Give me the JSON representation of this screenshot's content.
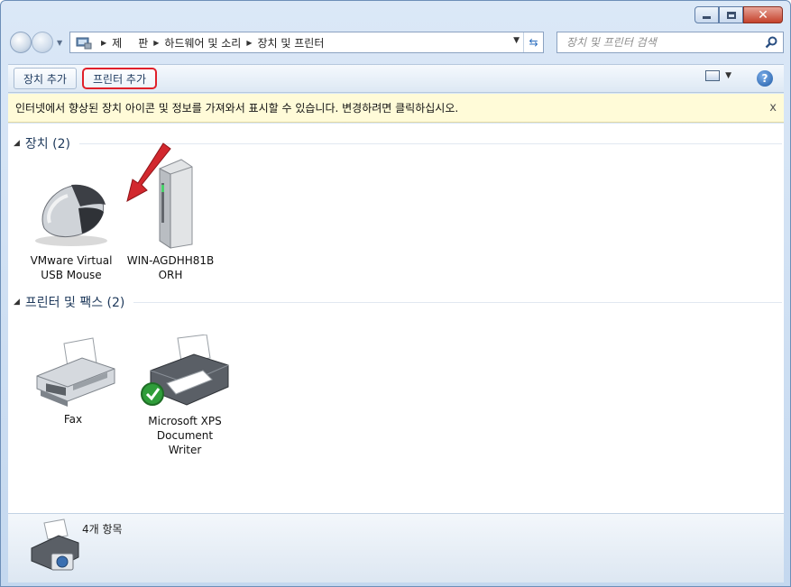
{
  "window": {
    "colors": {
      "highlight_border": "#e0202a",
      "info_bg": "#fffbd8",
      "group_text": "#1e395b"
    }
  },
  "address": {
    "crumbs": [
      "제어판",
      "하드웨어 및 소리",
      "장치 및 프린터"
    ],
    "visible_crumb_0": "제",
    "visible_crumb_0_tail": "판"
  },
  "search": {
    "placeholder": "장치 및 프린터 검색"
  },
  "toolbar": {
    "add_device_label": "장치 추가",
    "add_printer_label": "프린터 추가"
  },
  "infobar": {
    "message": "인터넷에서 향상된 장치 아이콘 및 정보를 가져와서 표시할 수 있습니다. 변경하려면 클릭하십시오.",
    "close_glyph": "x"
  },
  "groups": {
    "devices": {
      "title": "장치 (2)",
      "items": [
        {
          "label_line1": "VMware Virtual",
          "label_line2": "USB Mouse",
          "icon": "mouse-icon"
        },
        {
          "label_line1": "WIN-AGDHH81B",
          "label_line2": "ORH",
          "icon": "computer-tower-icon"
        }
      ]
    },
    "printers": {
      "title": "프린터 및 팩스 (2)",
      "items": [
        {
          "label_line1": "Fax",
          "label_line2": "",
          "icon": "fax-icon"
        },
        {
          "label_line1": "Microsoft XPS",
          "label_line2": "Document Writer",
          "icon": "printer-icon",
          "status": "default-checkmark"
        }
      ]
    }
  },
  "details": {
    "count_text": "4개 항목"
  }
}
